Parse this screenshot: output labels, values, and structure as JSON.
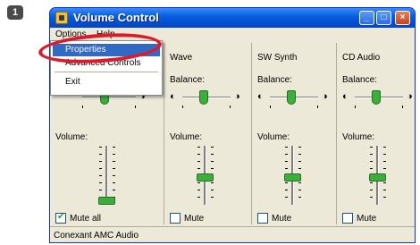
{
  "step_badge": "1",
  "window": {
    "title": "Volume Control",
    "controls": {
      "minimize": "_",
      "maximize": "□",
      "close": "×"
    }
  },
  "menubar": {
    "options_label": "Options",
    "help_label": "Help"
  },
  "dropdown": {
    "items": [
      "Properties",
      "Advanced Controls",
      "Exit"
    ],
    "highlighted": "Properties"
  },
  "columns": [
    {
      "label": "",
      "balance_label": "",
      "volume_label": "Volume:",
      "volume_level_percent": 0,
      "mute_label": "Mute all",
      "muted": true
    },
    {
      "label": "Wave",
      "balance_label": "Balance:",
      "volume_label": "Volume:",
      "volume_level_percent": 45,
      "mute_label": "Mute",
      "muted": false
    },
    {
      "label": "SW Synth",
      "balance_label": "Balance:",
      "volume_label": "Volume:",
      "volume_level_percent": 45,
      "mute_label": "Mute",
      "muted": false
    },
    {
      "label": "CD Audio",
      "balance_label": "Balance:",
      "volume_label": "Volume:",
      "volume_level_percent": 45,
      "mute_label": "Mute",
      "muted": false
    }
  ],
  "speaker_glyphs": {
    "left": "◐",
    "right": "◑"
  },
  "statusbar": {
    "text": "Conexant AMC Audio"
  },
  "colors": {
    "accent": "#316ac5",
    "highlight_ring": "#e0182a",
    "slider_thumb": "#3ab03a",
    "titlebar": "#0450d4"
  },
  "icons": [
    "volume-control-icon",
    "speaker-left-icon",
    "speaker-right-icon",
    "checkmark-icon"
  ]
}
